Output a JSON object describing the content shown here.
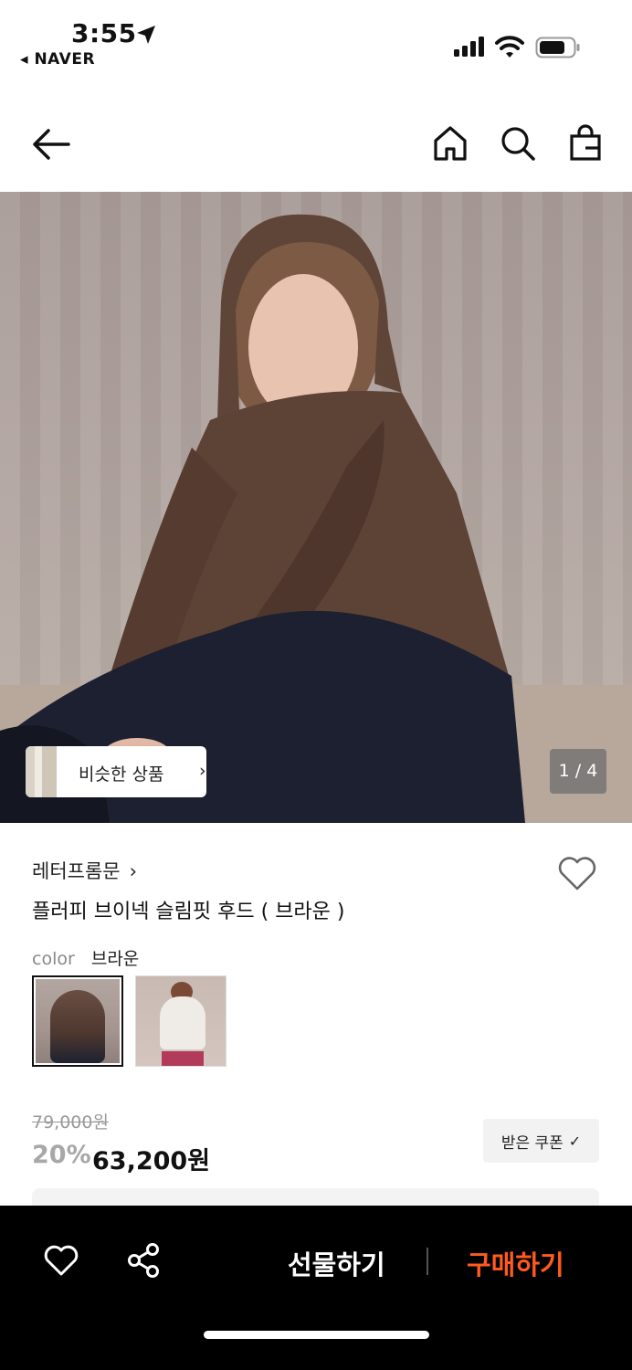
{
  "status_bar": {
    "time": "3:55",
    "back_app": "◂ NAVER"
  },
  "product": {
    "brand": "레터프롬문",
    "brand_chevron": "›",
    "name": "플러피 브이넥 슬림핏 후드 ( 브라운 )",
    "color_key": "color",
    "color_value": "브라운",
    "original_price": "79,000원",
    "discount": "20%",
    "sale_price": "63,200원",
    "coupon_label": "받은 쿠폰",
    "coupon_check": "✓"
  },
  "hero": {
    "similar_label": "비슷한 상품",
    "similar_chevron": "›",
    "page_counter": "1 / 4"
  },
  "bottom_bar": {
    "gift_label": "선물하기",
    "buy_label": "구매하기"
  },
  "colors": {
    "accent": "#ff5a1f",
    "bottom_bar": "#000000"
  },
  "icons": [
    "location-arrow-icon",
    "signal-icon",
    "wifi-icon",
    "battery-icon",
    "back-arrow-icon",
    "home-icon",
    "search-icon",
    "shopping-bag-icon",
    "heart-icon",
    "share-icon",
    "chevron-right-icon"
  ]
}
